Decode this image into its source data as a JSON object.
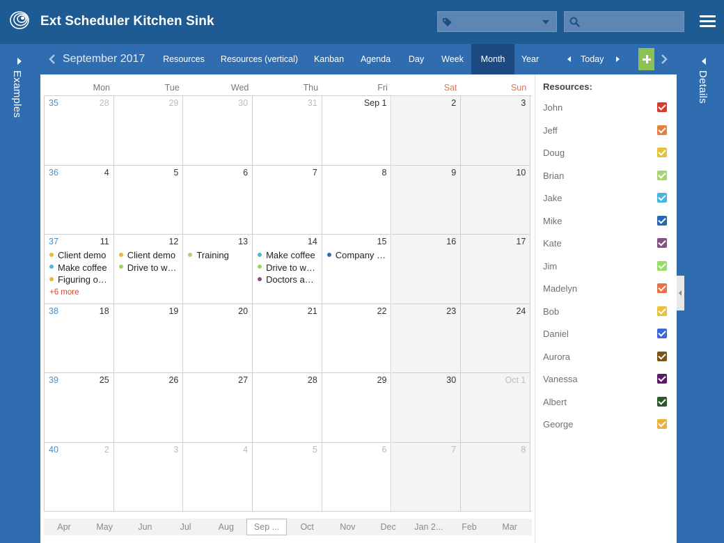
{
  "app": {
    "title": "Ext Scheduler Kitchen Sink"
  },
  "icons": {
    "logo": "spiral-logo-icon",
    "tag": "tag-icon",
    "search": "search-icon",
    "menu": "hamburger-menu-icon"
  },
  "sidebars": {
    "left_label": "Examples",
    "right_label": "Details"
  },
  "calendar": {
    "month_title": "September 2017",
    "views": [
      "Resources",
      "Resources (vertical)",
      "Kanban",
      "Agenda",
      "Day",
      "Week",
      "Month",
      "Year"
    ],
    "active_view": "Month",
    "today_label": "Today",
    "day_headers": [
      "Mon",
      "Tue",
      "Wed",
      "Thu",
      "Fri",
      "Sat",
      "Sun"
    ],
    "weeks": [
      {
        "week": "35",
        "days": [
          {
            "label": "28",
            "other_month": true
          },
          {
            "label": "29",
            "other_month": true
          },
          {
            "label": "30",
            "other_month": true
          },
          {
            "label": "31",
            "other_month": true
          },
          {
            "label": "Sep 1"
          },
          {
            "label": "2"
          },
          {
            "label": "3"
          }
        ]
      },
      {
        "week": "36",
        "days": [
          {
            "label": "4"
          },
          {
            "label": "5"
          },
          {
            "label": "6"
          },
          {
            "label": "7"
          },
          {
            "label": "8"
          },
          {
            "label": "9"
          },
          {
            "label": "10"
          }
        ]
      },
      {
        "week": "37",
        "days": [
          {
            "label": "11",
            "events": [
              {
                "title": "Client demo",
                "color": "#e8b73c"
              },
              {
                "title": "Make coffee",
                "color": "#4fb6d6"
              },
              {
                "title": "Figuring out stuff",
                "color": "#e8b73c"
              }
            ],
            "more": "+6 more"
          },
          {
            "label": "12",
            "events": [
              {
                "title": "Client demo",
                "color": "#e8b73c"
              },
              {
                "title": "Drive to work",
                "color": "#8fdc5c"
              }
            ]
          },
          {
            "label": "13",
            "events": [
              {
                "title": "Training",
                "color": "#a8d171"
              }
            ]
          },
          {
            "label": "14",
            "events": [
              {
                "title": "Make coffee",
                "color": "#4fb6d6"
              },
              {
                "title": "Drive to work",
                "color": "#8fdc5c"
              },
              {
                "title": "Doctors appointment",
                "color": "#8a4f8a"
              }
            ]
          },
          {
            "label": "15",
            "events": [
              {
                "title": "Company meeting",
                "color": "#2b6cb0"
              }
            ]
          },
          {
            "label": "16"
          },
          {
            "label": "17"
          }
        ]
      },
      {
        "week": "38",
        "days": [
          {
            "label": "18"
          },
          {
            "label": "19"
          },
          {
            "label": "20"
          },
          {
            "label": "21"
          },
          {
            "label": "22"
          },
          {
            "label": "23"
          },
          {
            "label": "24"
          }
        ]
      },
      {
        "week": "39",
        "days": [
          {
            "label": "25"
          },
          {
            "label": "26"
          },
          {
            "label": "27"
          },
          {
            "label": "28"
          },
          {
            "label": "29"
          },
          {
            "label": "30"
          },
          {
            "label": "Oct 1",
            "other_month": true
          }
        ]
      },
      {
        "week": "40",
        "days": [
          {
            "label": "2",
            "other_month": true
          },
          {
            "label": "3",
            "other_month": true
          },
          {
            "label": "4",
            "other_month": true
          },
          {
            "label": "5",
            "other_month": true
          },
          {
            "label": "6",
            "other_month": true
          },
          {
            "label": "7",
            "other_month": true
          },
          {
            "label": "8",
            "other_month": true
          }
        ]
      }
    ],
    "months_strip": [
      "Apr",
      "May",
      "Jun",
      "Jul",
      "Aug",
      "Sep ...",
      "Oct",
      "Nov",
      "Dec",
      "Jan 2...",
      "Feb",
      "Mar"
    ],
    "months_strip_selected": "Sep ..."
  },
  "resources": {
    "title": "Resources:",
    "items": [
      {
        "name": "John",
        "color": "#d83b2e"
      },
      {
        "name": "Jeff",
        "color": "#ea7e3c"
      },
      {
        "name": "Doug",
        "color": "#e7c138"
      },
      {
        "name": "Brian",
        "color": "#a9d475"
      },
      {
        "name": "Jake",
        "color": "#4bb6dd"
      },
      {
        "name": "Mike",
        "color": "#2767b4"
      },
      {
        "name": "Kate",
        "color": "#8a5083"
      },
      {
        "name": "Jim",
        "color": "#93e067"
      },
      {
        "name": "Madelyn",
        "color": "#e9724a"
      },
      {
        "name": "Bob",
        "color": "#ebc03a"
      },
      {
        "name": "Daniel",
        "color": "#3a66e0"
      },
      {
        "name": "Aurora",
        "color": "#7a5416"
      },
      {
        "name": "Vanessa",
        "color": "#5a1a68"
      },
      {
        "name": "Albert",
        "color": "#2c5a26"
      },
      {
        "name": "George",
        "color": "#e8b33a"
      }
    ]
  }
}
